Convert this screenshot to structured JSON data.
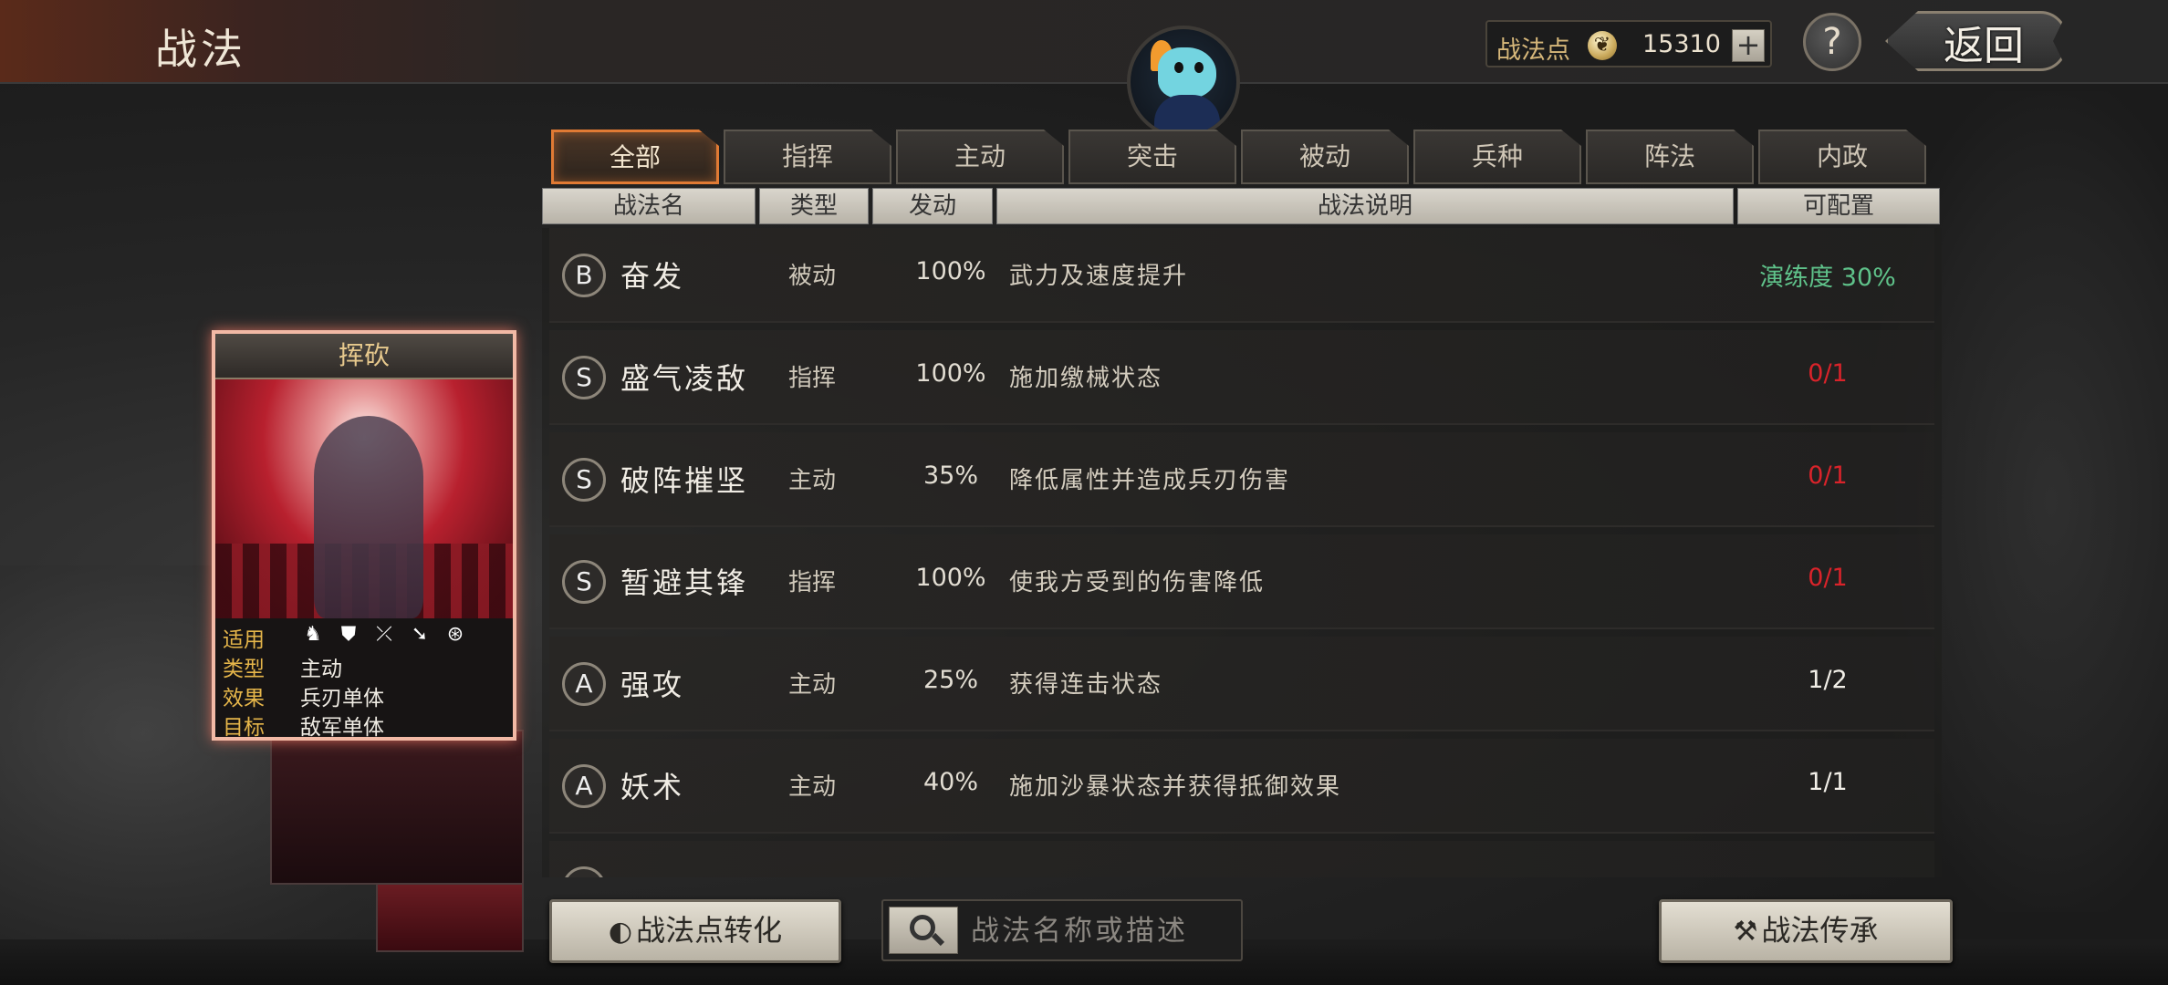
{
  "header": {
    "title": "战法",
    "points_label": "战法点",
    "points_value": "15310",
    "plus_label": "+",
    "help_label": "?",
    "back_label": "返回"
  },
  "tabs": [
    {
      "label": "全部",
      "active": true
    },
    {
      "label": "指挥",
      "active": false
    },
    {
      "label": "主动",
      "active": false
    },
    {
      "label": "突击",
      "active": false
    },
    {
      "label": "被动",
      "active": false
    },
    {
      "label": "兵种",
      "active": false
    },
    {
      "label": "阵法",
      "active": false
    },
    {
      "label": "内政",
      "active": false
    }
  ],
  "columns": [
    "战法名",
    "类型",
    "发动",
    "战法说明",
    "可配置"
  ],
  "skills": [
    {
      "grade": "B",
      "name": "奋发",
      "type": "被动",
      "rate": "100%",
      "desc": "武力及速度提升",
      "slots": "演练度 30%",
      "slots_color": "#5fc28a"
    },
    {
      "grade": "S",
      "name": "盛气凌敌",
      "type": "指挥",
      "rate": "100%",
      "desc": "施加缴械状态",
      "slots": "0/1",
      "slots_color": "#d9232a"
    },
    {
      "grade": "S",
      "name": "破阵摧坚",
      "type": "主动",
      "rate": "35%",
      "desc": "降低属性并造成兵刃伤害",
      "slots": "0/1",
      "slots_color": "#d9232a"
    },
    {
      "grade": "S",
      "name": "暂避其锋",
      "type": "指挥",
      "rate": "100%",
      "desc": "使我方受到的伤害降低",
      "slots": "0/1",
      "slots_color": "#d9232a"
    },
    {
      "grade": "A",
      "name": "强攻",
      "type": "主动",
      "rate": "25%",
      "desc": "获得连击状态",
      "slots": "1/2",
      "slots_color": "#f2efe8"
    },
    {
      "grade": "A",
      "name": "妖术",
      "type": "主动",
      "rate": "40%",
      "desc": "施加沙暴状态并获得抵御效果",
      "slots": "1/1",
      "slots_color": "#f2efe8"
    }
  ],
  "card": {
    "title": "挥砍",
    "apply_key": "适用",
    "type_key": "类型",
    "type_val": "主动",
    "effect_key": "效果",
    "effect_val": "兵刃单体",
    "target_key": "目标",
    "target_val": "敌军单体",
    "unit_icons": [
      "cavalry-icon",
      "shield-icon",
      "bow-icon",
      "spear-icon",
      "siege-icon"
    ]
  },
  "buttons": {
    "convert_label": "战法点转化",
    "inherit_label": "战法传承",
    "search_placeholder": "战法名称或描述"
  },
  "colors": {
    "accent": "#e07a34",
    "red": "#d9232a",
    "green": "#5fc28a"
  }
}
